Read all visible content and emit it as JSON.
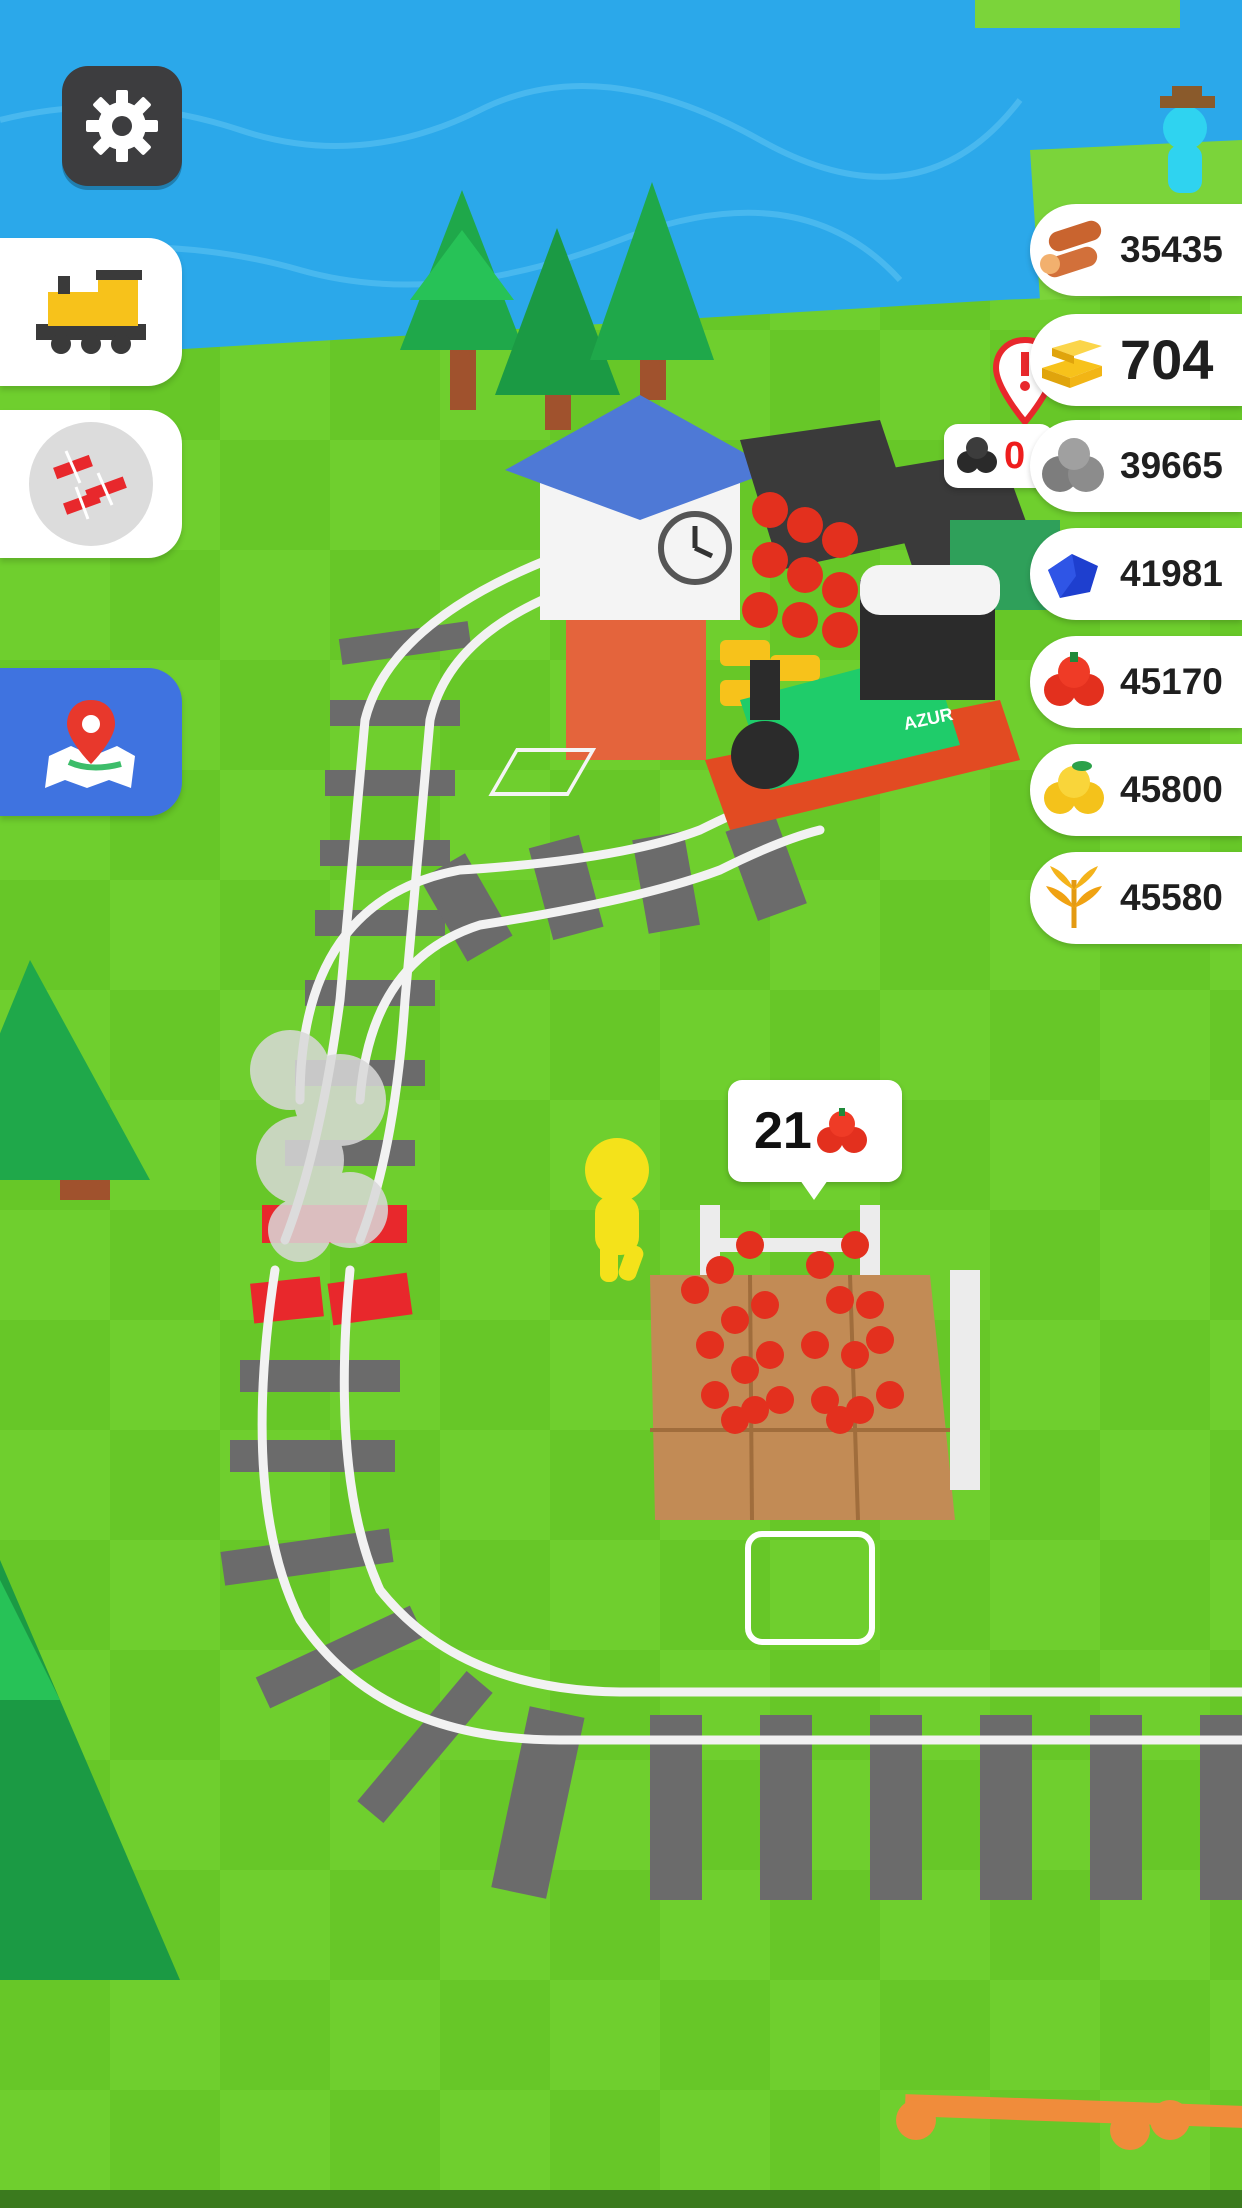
{
  "hud": {
    "settings_icon": "gear-icon",
    "side_buttons": [
      {
        "icon": "locomotive-icon"
      },
      {
        "icon": "rail-pieces-icon"
      },
      {
        "icon": "map-pin-icon"
      }
    ]
  },
  "resources": [
    {
      "name": "wood",
      "icon": "logs-icon",
      "value": "35435"
    },
    {
      "name": "gold",
      "icon": "gold-bars-icon",
      "value": "704"
    },
    {
      "name": "stone",
      "icon": "stone-icon",
      "value": "39665"
    },
    {
      "name": "sapphire",
      "icon": "blue-gem-icon",
      "value": "41981"
    },
    {
      "name": "tomato",
      "icon": "tomato-icon",
      "value": "45170"
    },
    {
      "name": "apple",
      "icon": "yellow-apple-icon",
      "value": "45800"
    },
    {
      "name": "wheat",
      "icon": "wheat-icon",
      "value": "45580"
    }
  ],
  "coal_alert": {
    "icon": "coal-icon",
    "value": "0"
  },
  "farm_bubble": {
    "value": "21",
    "icon": "tomato-icon"
  },
  "train": {
    "badge": "AZUR"
  },
  "colors": {
    "grass": "#6fcf2e",
    "water": "#2aa7e8",
    "track": "#6b6b6b",
    "rail": "#f0f0f0",
    "accent_red": "#e02b2b"
  }
}
